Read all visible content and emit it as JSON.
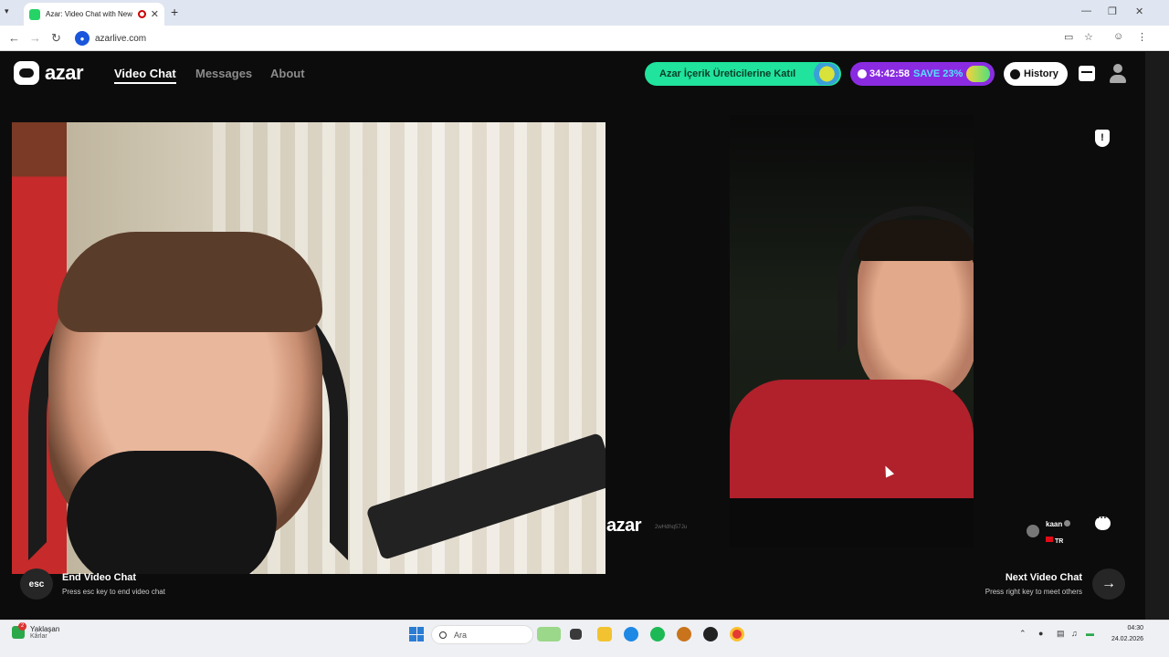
{
  "browser": {
    "tab_title": "Azar: Video Chat with New",
    "address": "azarlive.com"
  },
  "header": {
    "logo_text": "azar",
    "nav": [
      {
        "label": "Video Chat"
      },
      {
        "label": "Messages"
      },
      {
        "label": "About"
      }
    ],
    "promo_label": "Azar İçerik Üreticilerine Katıl",
    "timer": "34:42:58",
    "timer_offer": "SAVE 23%",
    "history_label": "History"
  },
  "call": {
    "watermark": "azar",
    "watermark_id": "2wHdhq57Ju",
    "peer_name": "kaan",
    "peer_country": "TR"
  },
  "controls": {
    "esc_key": "esc",
    "end_title": "End Video Chat",
    "end_hint": "Press esc key to end video chat",
    "next_title": "Next Video Chat",
    "next_hint": "Press right key to meet others",
    "next_icon": "→"
  },
  "taskbar": {
    "weather_badge": "2",
    "weather_title": "Yaklaşan",
    "weather_sub": "Kârlar",
    "search_placeholder": "Ara",
    "time": "04:30",
    "date": "24.02.2026"
  },
  "colors": {
    "promo": "#20e39d",
    "timer": "#8a2be2",
    "save": "#54e3ff",
    "background": "#0c0c0c"
  }
}
